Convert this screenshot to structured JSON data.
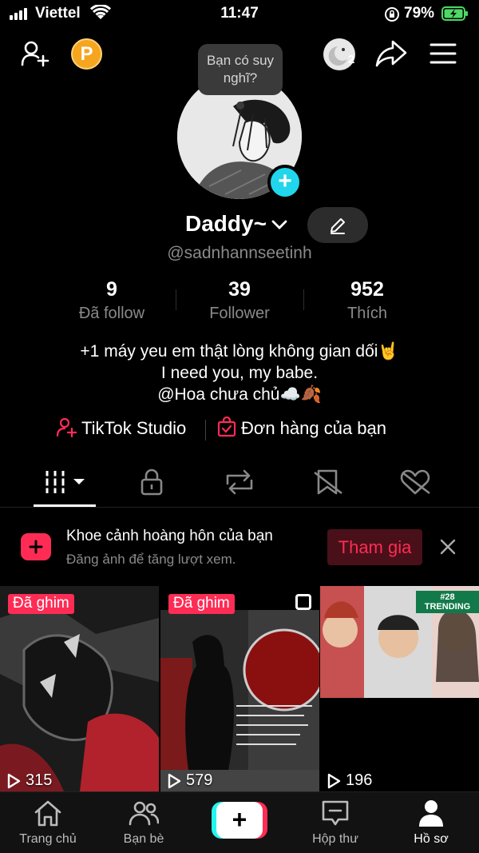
{
  "status_bar": {
    "carrier": "Viettel",
    "time": "11:47",
    "battery_percent": "79%"
  },
  "header": {
    "coin_label": "P",
    "notification_count": "2"
  },
  "profile": {
    "thought_bubble": "Bạn có suy nghĩ?",
    "display_name": "Daddy~",
    "handle": "@sadnhannseetinh",
    "stats": [
      {
        "value": "9",
        "label": "Đã follow"
      },
      {
        "value": "39",
        "label": "Follower"
      },
      {
        "value": "952",
        "label": "Thích"
      }
    ],
    "bio_lines": [
      "+1 máy yeu em thật lòng không gian dối🤘",
      "I need you, my babe.",
      "@Hoa chưa chủ☁️🍂"
    ],
    "links": {
      "studio": "TikTok Studio",
      "orders": "Đơn hàng của bạn"
    }
  },
  "promo": {
    "title": "Khoe cảnh hoàng hôn của bạn",
    "subtitle": "Đăng ảnh để tăng lượt xem.",
    "join_label": "Tham gia"
  },
  "videos": [
    {
      "pinned_label": "Đã ghim",
      "views": "315"
    },
    {
      "pinned_label": "Đã ghim",
      "views": "579"
    },
    {
      "pinned_label": "",
      "views": "196",
      "trending": "#28 TRENDING"
    }
  ],
  "bottom_nav": [
    {
      "label": "Trang chủ"
    },
    {
      "label": "Bạn bè"
    },
    {
      "label": ""
    },
    {
      "label": "Hộp thư"
    },
    {
      "label": "Hồ sơ"
    }
  ],
  "colors": {
    "accent_red": "#fe2c55",
    "accent_cyan": "#20d5ec",
    "coin_orange": "#f6a51f",
    "battery_green": "#4cd964"
  }
}
